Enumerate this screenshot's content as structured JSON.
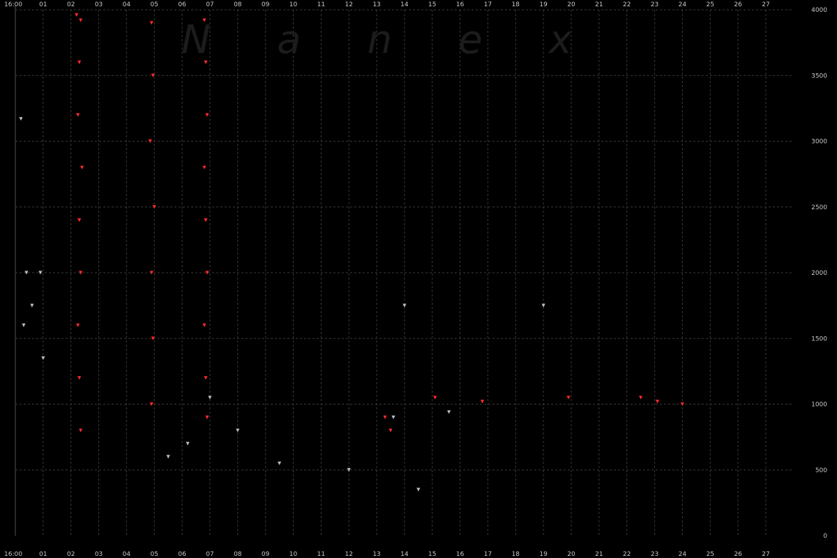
{
  "watermark": "N a n e x",
  "chart_data": {
    "type": "scatter",
    "title": "",
    "xlabel": "",
    "ylabel": "",
    "x_tick_labels": [
      "16:00",
      "01",
      "02",
      "03",
      "04",
      "05",
      "06",
      "07",
      "08",
      "09",
      "10",
      "11",
      "12",
      "13",
      "14",
      "15",
      "16",
      "17",
      "18",
      "19",
      "20",
      "21",
      "22",
      "23",
      "24",
      "25",
      "26",
      "27"
    ],
    "x_range": [
      0,
      27.8
    ],
    "ylim": [
      0,
      4000
    ],
    "y_ticks": [
      0,
      500,
      1000,
      1500,
      2000,
      2500,
      3000,
      3500,
      4000
    ],
    "y_tick_labels": [
      "0",
      "500",
      "1000",
      "1500",
      "2000",
      "2500",
      "3000",
      "3500",
      "4000"
    ],
    "grid": true,
    "marker": "small-triangle",
    "colors": {
      "primary": "#ff2a2a",
      "secondary": "#b4c0c8",
      "accent1": "#c860ff",
      "accent2": "#e6e040",
      "accent3": "#40c8ff",
      "accent4": "#40e040"
    },
    "series": [
      {
        "color": "#ff2a2a",
        "points": [
          [
            2.2,
            3960
          ],
          [
            2.35,
            3920
          ],
          [
            2.3,
            3600
          ],
          [
            2.25,
            3200
          ],
          [
            2.4,
            2800
          ],
          [
            2.3,
            2400
          ],
          [
            2.35,
            2000
          ],
          [
            2.25,
            1600
          ],
          [
            2.3,
            1200
          ],
          [
            2.35,
            800
          ],
          [
            4.9,
            3900
          ],
          [
            4.95,
            3500
          ],
          [
            4.85,
            3000
          ],
          [
            5.0,
            2500
          ],
          [
            4.9,
            2000
          ],
          [
            4.95,
            1500
          ],
          [
            4.9,
            1000
          ],
          [
            6.8,
            3920
          ],
          [
            6.85,
            3600
          ],
          [
            6.9,
            3200
          ],
          [
            6.8,
            2800
          ],
          [
            6.85,
            2400
          ],
          [
            6.9,
            2000
          ],
          [
            6.8,
            1600
          ],
          [
            6.85,
            1200
          ],
          [
            6.9,
            900
          ],
          [
            15.1,
            1050
          ],
          [
            16.8,
            1020
          ],
          [
            19.9,
            1050
          ],
          [
            22.5,
            1050
          ],
          [
            23.1,
            1020
          ],
          [
            24.0,
            1000
          ],
          [
            13.3,
            900
          ],
          [
            13.5,
            800
          ]
        ]
      },
      {
        "color": "#b4c0c8",
        "points": [
          [
            0.4,
            2000
          ],
          [
            0.9,
            2000
          ],
          [
            0.6,
            1750
          ],
          [
            1.0,
            1350
          ],
          [
            14.0,
            1750
          ],
          [
            19.0,
            1750
          ],
          [
            7.0,
            1050
          ],
          [
            8.0,
            800
          ],
          [
            9.5,
            550
          ],
          [
            12.0,
            500
          ],
          [
            13.6,
            900
          ],
          [
            14.5,
            350
          ],
          [
            15.6,
            940
          ],
          [
            5.5,
            600
          ],
          [
            6.2,
            700
          ],
          [
            0.2,
            3170
          ],
          [
            0.3,
            1600
          ]
        ]
      }
    ]
  }
}
